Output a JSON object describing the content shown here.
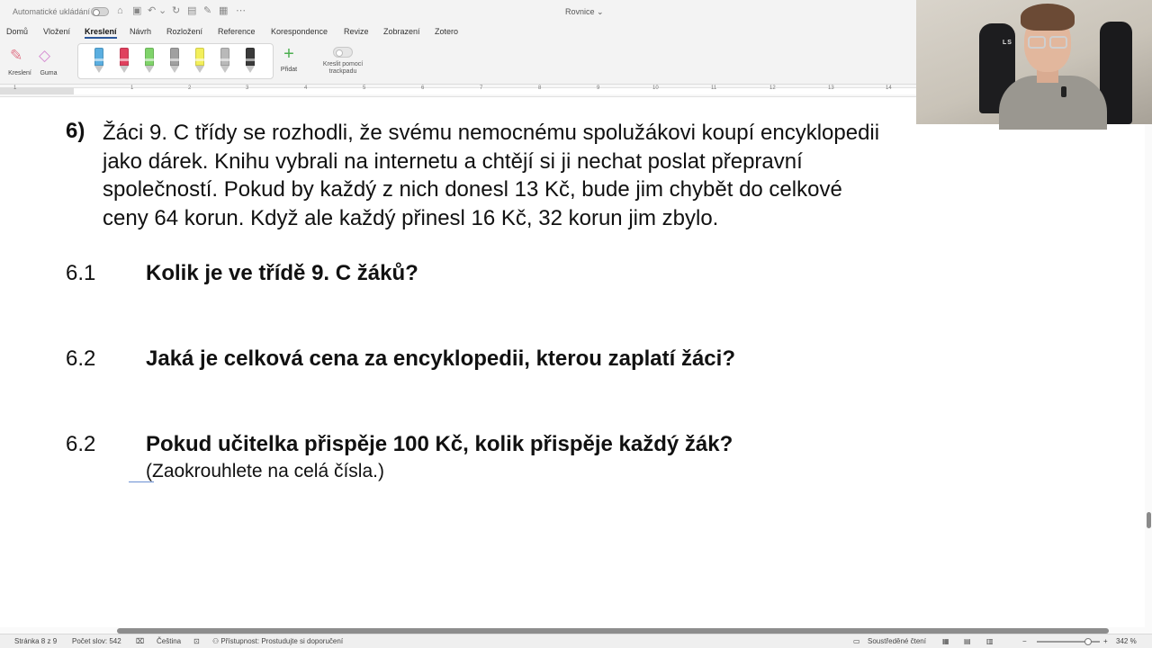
{
  "titlebar": {
    "autosave_label": "Automatické ukládání",
    "document_title": "Rovnice"
  },
  "ribbon_tabs": [
    "Domů",
    "Vložení",
    "Kreslení",
    "Návrh",
    "Rozložení",
    "Reference",
    "Korespondence",
    "Revize",
    "Zobrazení",
    "Zotero"
  ],
  "active_tab": "Kreslení",
  "ribbon": {
    "draw_label": "Kreslení",
    "eraser_label": "Guma",
    "add_label": "Přidat",
    "trackpad_label_1": "Kreslit pomocí",
    "trackpad_label_2": "trackpadu",
    "pens": [
      {
        "name": "blue-pen",
        "color": "#5aaee0"
      },
      {
        "name": "red-pen",
        "color": "#e0405e"
      },
      {
        "name": "green-pen",
        "color": "#7fd36a"
      },
      {
        "name": "gray-pencil",
        "color": "#a0a0a0"
      },
      {
        "name": "yellow-highlighter",
        "color": "#f3ef5b"
      },
      {
        "name": "silver-pen",
        "color": "#b9b9b9"
      },
      {
        "name": "black-pen",
        "color": "#3a3a3a"
      }
    ]
  },
  "ruler": {
    "numbers": [
      "1",
      "1",
      "2",
      "3",
      "4",
      "5",
      "6",
      "7",
      "8",
      "9",
      "10",
      "11",
      "12",
      "13",
      "14"
    ]
  },
  "document": {
    "task_number": "6)",
    "paragraph_lines": [
      "Žáci 9. C třídy se rozhodli, že svému nemocnému spolužákovi koupí encyklopedii",
      "jako dárek. Knihu vybrali na internetu a chtějí si ji nechat poslat přepravní",
      "společností. Pokud by každý z nich donesl 13 Kč, bude jim chybět do celkové",
      "ceny 64 korun. Když ale každý přinesl 16 Kč, 32 korun jim zbylo."
    ],
    "questions": [
      {
        "num": "6.1",
        "text": "Kolik je ve třídě 9. C žáků?"
      },
      {
        "num": "6.2",
        "text": "Jaká je celková cena za encyklopedii, kterou zaplatí žáci?"
      },
      {
        "num": "6.2",
        "text": "Pokud učitelka přispěje 100 Kč, kolik přispěje každý žák?"
      }
    ],
    "note": "(Zaokrouhlete na celá čísla.)"
  },
  "statusbar": {
    "page": "Stránka 8 z 9",
    "word_count": "Počet slov: 542",
    "language": "Čeština",
    "accessibility": "Přístupnost: Prostudujte si doporučení",
    "focus_mode": "Soustředěné čtení",
    "zoom": "342 %"
  }
}
